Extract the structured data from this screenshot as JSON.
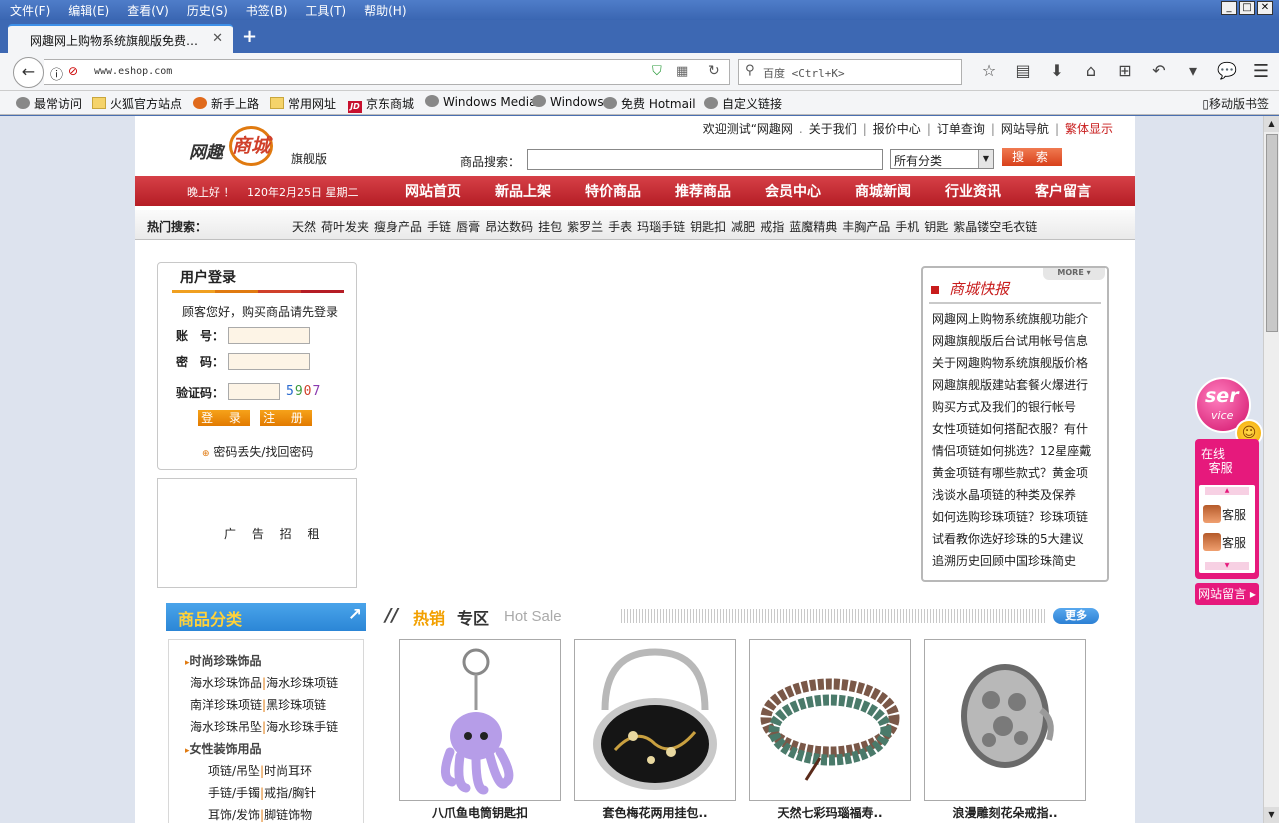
{
  "browser": {
    "menu": [
      "文件(F)",
      "编辑(E)",
      "查看(V)",
      "历史(S)",
      "书签(B)",
      "工具(T)",
      "帮助(H)"
    ],
    "tab_title": "网趣网上购物系统旗舰版免费…",
    "url": "www.eshop.com",
    "search_placeholder": "百度 <Ctrl+K>",
    "bookmarks": [
      "最常访问",
      "火狐官方站点",
      "新手上路",
      "常用网址",
      "京东商城",
      "Windows Media",
      "Windows",
      "免费 Hotmail",
      "自定义链接"
    ],
    "mobile_bookmarks": "移动版书签"
  },
  "site": {
    "logo": {
      "left": "网趣",
      "right": "商城"
    },
    "edition": "旗舰版",
    "top_links": [
      "欢迎测试“网趣网",
      "关于我们",
      "报价中心",
      "订单查询",
      "网站导航"
    ],
    "traditional": "繁体显示",
    "search_label": "商品搜索：",
    "category_select": "所有分类",
    "search_button": "搜 索",
    "greeting": "晚上好 ！",
    "date": "120年2月25日 星期二",
    "nav": [
      "网站首页",
      "新品上架",
      "特价商品",
      "推荐商品",
      "会员中心",
      "商城新闻",
      "行业资讯",
      "客户留言"
    ],
    "hot_label": "热门搜索：",
    "hot_words": [
      "天然",
      "荷叶发夹",
      "瘦身产品",
      "手链",
      "唇膏",
      "昂达数码",
      "挂包",
      "紫罗兰",
      "手表",
      "玛瑙手链",
      "钥匙扣",
      "减肥",
      "戒指",
      "蓝魔精典",
      "丰胸产品",
      "手机",
      "钥匙",
      "紫晶镂空毛衣链"
    ]
  },
  "login": {
    "title": "用户登录",
    "welcome": "顾客您好，购买商品请先登录",
    "account_label": "账　号：",
    "password_label": "密　码：",
    "captcha_label": "验证码：",
    "captcha": [
      "5",
      "9",
      "0",
      "7"
    ],
    "login_button": "登 录",
    "register_button": "注 册",
    "forgot": "密码丢失/找回密码"
  },
  "ad": {
    "text": "广 告 招 租"
  },
  "news": {
    "title": "商城快报",
    "more": "MORE",
    "items": [
      "网趣网上购物系统旗舰功能介",
      "网趣旗舰版后台试用帐号信息",
      "关于网趣购物系统旗舰版价格",
      "网趣旗舰版建站套餐火爆进行",
      "购买方式及我们的银行帐号",
      "女性项链如何搭配衣服？有什",
      "情侣项链如何挑选？12星座戴",
      "黄金项链有哪些款式？黄金项",
      "浅谈水晶项链的种类及保养",
      "如何选购珍珠项链？珍珠项链",
      "试看教你选好珍珠的5大建议",
      "追溯历史回顾中国珍珠简史"
    ]
  },
  "categories": {
    "title": "商品分类",
    "groups": [
      {
        "name": "时尚珍珠饰品",
        "rows": [
          [
            "海水珍珠饰品",
            "海水珍珠项链"
          ],
          [
            "南洋珍珠项链",
            "黑珍珠项链"
          ],
          [
            "海水珍珠吊坠",
            "海水珍珠手链"
          ]
        ]
      },
      {
        "name": "女性装饰用品",
        "rows": [
          [
            "项链/吊坠",
            "时尚耳环"
          ],
          [
            "手链/手镯",
            "戒指/胸针"
          ],
          [
            "耳饰/发饰",
            "脚链饰物"
          ]
        ]
      }
    ]
  },
  "hotsale": {
    "title_a": "热销",
    "title_b": "专区",
    "title_en": "Hot Sale",
    "more": "更多",
    "products": [
      "八爪鱼电筒钥匙扣",
      "套色梅花两用挂包..",
      "天然七彩玛瑙福寿..",
      "浪漫雕刻花朵戒指.."
    ]
  },
  "service": {
    "ball_top": "ser",
    "ball_bottom": "vice",
    "online": "在线",
    "service": "客服",
    "agents": [
      "客服",
      "客服"
    ],
    "message": "网站留言"
  },
  "colors": {
    "brand_red": "#b51d25",
    "accent_orange": "#e27a00",
    "link_blue": "#2b86d6",
    "service_pink": "#e6197c"
  }
}
